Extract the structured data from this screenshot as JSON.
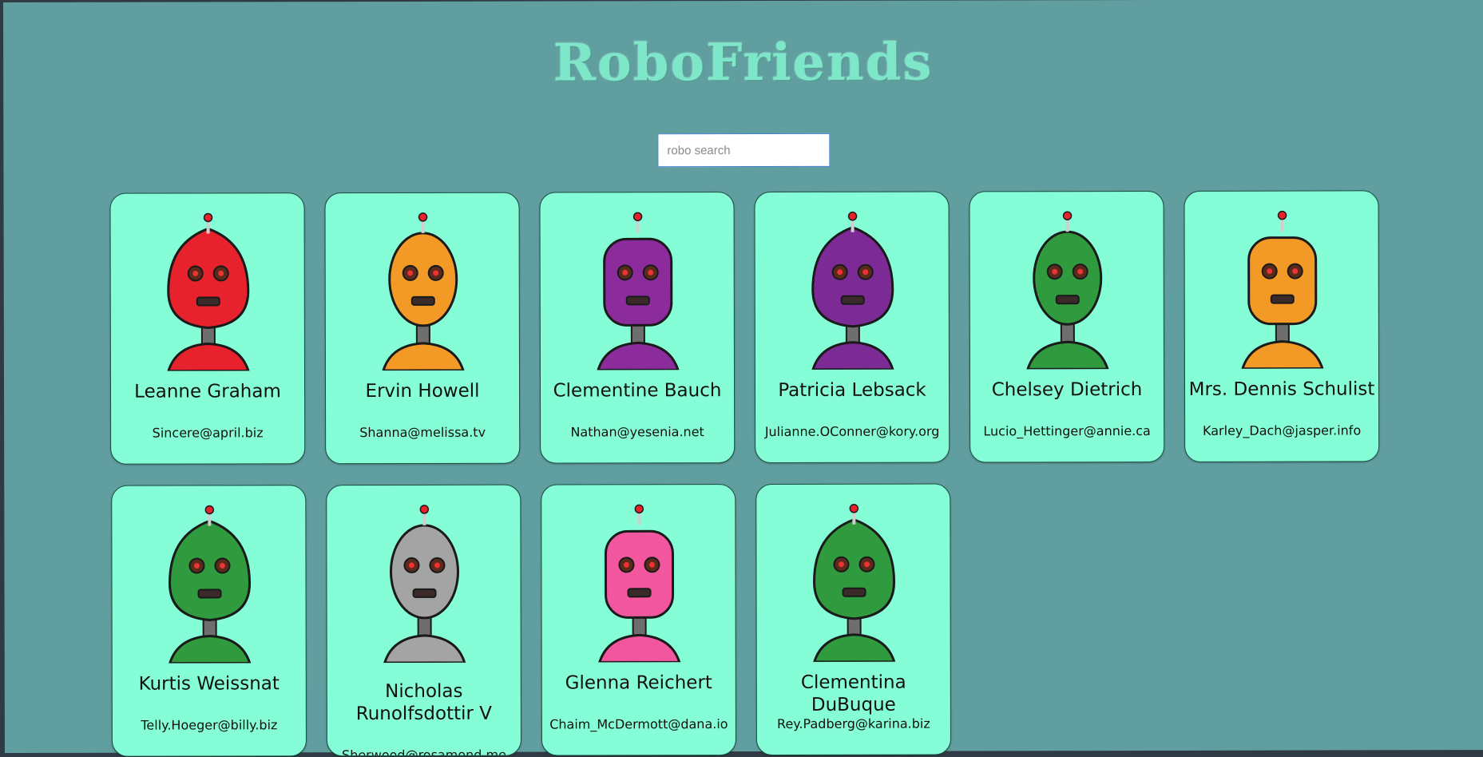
{
  "app": {
    "title": "RoboFriends"
  },
  "search": {
    "placeholder": "robo search",
    "value": ""
  },
  "robots": [
    {
      "name": "Leanne Graham",
      "email": "Sincere@april.biz",
      "color": "#e8222c",
      "icon": "robot-red-avatar"
    },
    {
      "name": "Ervin Howell",
      "email": "Shanna@melissa.tv",
      "color": "#f39a26",
      "icon": "robot-orange-avatar"
    },
    {
      "name": "Clementine Bauch",
      "email": "Nathan@yesenia.net",
      "color": "#8b2b9c",
      "icon": "robot-purple-avatar"
    },
    {
      "name": "Patricia Lebsack",
      "email": "Julianne.OConner@kory.org",
      "color": "#7c2a96",
      "icon": "robot-purple-avatar"
    },
    {
      "name": "Chelsey Dietrich",
      "email": "Lucio_Hettinger@annie.ca",
      "color": "#2f9a3e",
      "icon": "robot-green-avatar"
    },
    {
      "name": "Mrs. Dennis Schulist",
      "email": "Karley_Dach@jasper.info",
      "color": "#f39a26",
      "icon": "robot-orange-avatar"
    },
    {
      "name": "Kurtis Weissnat",
      "email": "Telly.Hoeger@billy.biz",
      "color": "#2f9a3e",
      "icon": "robot-green-avatar"
    },
    {
      "name": "Nicholas Runolfsdottir V",
      "email": "Sherwood@rosamond.me",
      "color": "#a4a4a4",
      "icon": "robot-gray-avatar"
    },
    {
      "name": "Glenna Reichert",
      "email": "Chaim_McDermott@dana.io",
      "color": "#f2569f",
      "icon": "robot-pink-avatar"
    },
    {
      "name": "Clementina DuBuque",
      "email": "Rey.Padberg@karina.biz",
      "color": "#2f9a3e",
      "icon": "robot-green-avatar"
    }
  ]
}
